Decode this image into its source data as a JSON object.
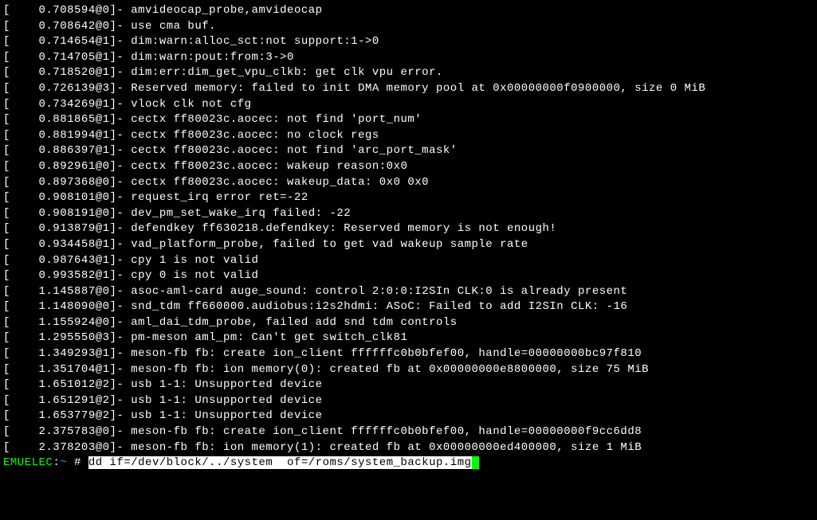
{
  "log_lines": [
    "[    0.708594@0]- amvideocap_probe,amvideocap",
    "[    0.708642@0]- use cma buf.",
    "[    0.714654@1]- dim:warn:alloc_sct:not support:1->0",
    "[    0.714705@1]- dim:warn:pout:from:3->0",
    "[    0.718520@1]- dim:err:dim_get_vpu_clkb: get clk vpu error.",
    "[    0.726139@3]- Reserved memory: failed to init DMA memory pool at 0x00000000f0900000, size 0 MiB",
    "[    0.734269@1]- vlock clk not cfg",
    "[    0.881865@1]- cectx ff80023c.aocec: not find 'port_num'",
    "[    0.881994@1]- cectx ff80023c.aocec: no clock regs",
    "[    0.886397@1]- cectx ff80023c.aocec: not find 'arc_port_mask'",
    "[    0.892961@0]- cectx ff80023c.aocec: wakeup reason:0x0",
    "[    0.897368@0]- cectx ff80023c.aocec: wakeup_data: 0x0 0x0",
    "[    0.908101@0]- request_irq error ret=-22",
    "[    0.908191@0]- dev_pm_set_wake_irq failed: -22",
    "[    0.913879@1]- defendkey ff630218.defendkey: Reserved memory is not enough!",
    "[    0.934458@1]- vad_platform_probe, failed to get vad wakeup sample rate",
    "[    0.987643@1]- cpy 1 is not valid",
    "[    0.993582@1]- cpy 0 is not valid",
    "[    1.145887@0]- asoc-aml-card auge_sound: control 2:0:0:I2SIn CLK:0 is already present",
    "[    1.148090@0]- snd_tdm ff660000.audiobus:i2s2hdmi: ASoC: Failed to add I2SIn CLK: -16",
    "[    1.155924@0]- aml_dai_tdm_probe, failed add snd tdm controls",
    "[    1.295550@3]- pm-meson aml_pm: Can't get switch_clk81",
    "[    1.349293@1]- meson-fb fb: create ion_client ffffffc0b0bfef00, handle=00000000bc97f810",
    "[    1.351704@1]- meson-fb fb: ion memory(0): created fb at 0x00000000e8800000, size 75 MiB",
    "[    1.651012@2]- usb 1-1: Unsupported device",
    "[    1.651291@2]- usb 1-1: Unsupported device",
    "[    1.653779@2]- usb 1-1: Unsupported device",
    "[    2.375783@0]- meson-fb fb: create ion_client ffffffc0b0bfef00, handle=00000000f9cc6dd8",
    "[    2.378203@0]- meson-fb fb: ion memory(1): created fb at 0x00000000ed400000, size 1 MiB"
  ],
  "prompt": {
    "host": "EMUELEC",
    "path": "~",
    "symbol": "#",
    "command": "dd if=/dev/block/../system  of=/roms/system_backup.img"
  }
}
